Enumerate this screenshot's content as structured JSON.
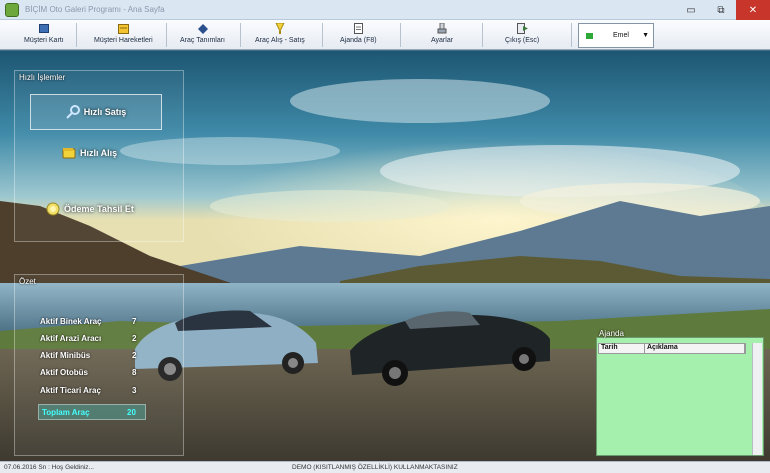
{
  "window": {
    "title": "BİÇİM Oto Galeri Programı - Ana Sayfa",
    "controls": {
      "minimize": "▭",
      "maximize": "⧉",
      "close": "✕"
    }
  },
  "toolbar": {
    "items": [
      {
        "label": "Müşteri Kartı",
        "icon": "customer-card-icon"
      },
      {
        "label": "Müşteri Hareketleri",
        "icon": "customer-moves-icon"
      },
      {
        "label": "Araç Tanımları",
        "icon": "car-definitions-icon"
      },
      {
        "label": "Araç Alış - Satış",
        "icon": "buy-sell-icon"
      },
      {
        "label": "Ajanda (F8)",
        "icon": "agenda-icon"
      },
      {
        "label": "Ayarlar",
        "icon": "settings-icon"
      },
      {
        "label": "Çıkış (Esc)",
        "icon": "exit-icon"
      }
    ],
    "user": {
      "name": "Emel",
      "status_color": "#2fa83a"
    }
  },
  "quick": {
    "title": "Hızlı İşlemler",
    "sell": "Hızlı Satış",
    "buy": "Hızlı Alış",
    "payment": "Ödeme Tahsil Et"
  },
  "summary": {
    "title": "Özet",
    "rows": [
      {
        "label": "Aktif Binek Araç",
        "value": "7"
      },
      {
        "label": "Aktif Arazi Aracı",
        "value": "2"
      },
      {
        "label": "Aktif Minibüs",
        "value": "2"
      },
      {
        "label": "Aktif Otobüs",
        "value": "8"
      },
      {
        "label": "Aktif Ticari Araç",
        "value": "3"
      }
    ],
    "total_label": "Toplam Araç",
    "total_value": "20"
  },
  "agenda": {
    "title": "Ajanda",
    "columns": [
      "Tarih",
      "Açıklama"
    ],
    "background": "#a6f0ad"
  },
  "status": {
    "left": "07.06.2016 Sn : Hoş Geldiniz...",
    "center": "DEMO (KISITLANMIŞ ÖZELLİKLİ) KULLANMAKTASINIZ"
  }
}
